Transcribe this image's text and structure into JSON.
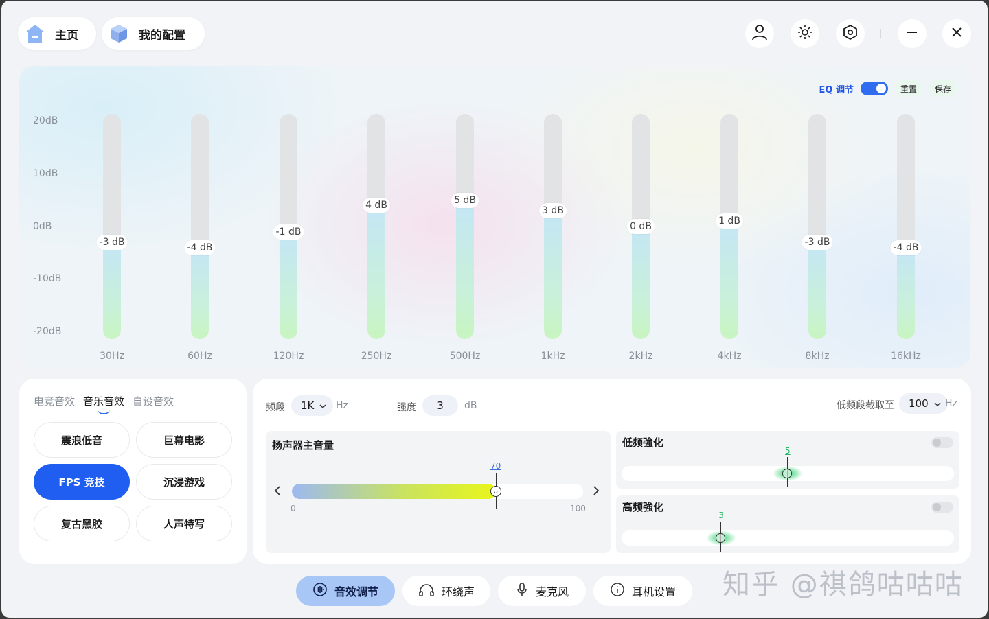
{
  "header": {
    "home_label": "主页",
    "config_label": "我的配置"
  },
  "eq": {
    "toggle_label": "EQ 调节",
    "toggle_on": true,
    "reset_label": "重置",
    "save_label": "保存",
    "y_labels": [
      "20dB",
      "10dB",
      "0dB",
      "-10dB",
      "-20dB"
    ],
    "bands": [
      {
        "freq": "30Hz",
        "gain": -3,
        "label": "-3 dB"
      },
      {
        "freq": "60Hz",
        "gain": -4,
        "label": "-4 dB"
      },
      {
        "freq": "120Hz",
        "gain": -1,
        "label": "-1 dB"
      },
      {
        "freq": "250Hz",
        "gain": 4,
        "label": "4 dB"
      },
      {
        "freq": "500Hz",
        "gain": 5,
        "label": "5 dB"
      },
      {
        "freq": "1kHz",
        "gain": 3,
        "label": "3 dB"
      },
      {
        "freq": "2kHz",
        "gain": 0,
        "label": "0 dB"
      },
      {
        "freq": "4kHz",
        "gain": 1,
        "label": "1 dB"
      },
      {
        "freq": "8kHz",
        "gain": -3,
        "label": "-3 dB"
      },
      {
        "freq": "16kHz",
        "gain": -4,
        "label": "-4 dB"
      }
    ]
  },
  "presets": {
    "tabs": [
      "电竞音效",
      "音乐音效",
      "自设音效"
    ],
    "buttons": [
      "震浪低音",
      "巨幕电影",
      "FPS 竞技",
      "沉浸游戏",
      "复古黑胶",
      "人声特写"
    ]
  },
  "controls": {
    "band_label": "频段",
    "band_value": "1K",
    "band_unit": "Hz",
    "strength_label": "强度",
    "strength_value": "3",
    "strength_unit": "dB",
    "lowcut_label": "低频段截取至",
    "lowcut_value": "100",
    "lowcut_unit": "Hz",
    "volume": {
      "title": "扬声器主音量",
      "value": "70",
      "min": "0",
      "max": "100",
      "level": 0.7
    },
    "bass": {
      "title": "低频強化",
      "value": "5",
      "enabled": false,
      "level": 0.5
    },
    "treble": {
      "title": "高频強化",
      "value": "3",
      "enabled": false,
      "level": 0.3
    }
  },
  "bottom_tabs": [
    "音效调节",
    "环绕声",
    "麦克风",
    "耳机设置"
  ],
  "watermark": "知乎 @祺鸽咕咕咕"
}
